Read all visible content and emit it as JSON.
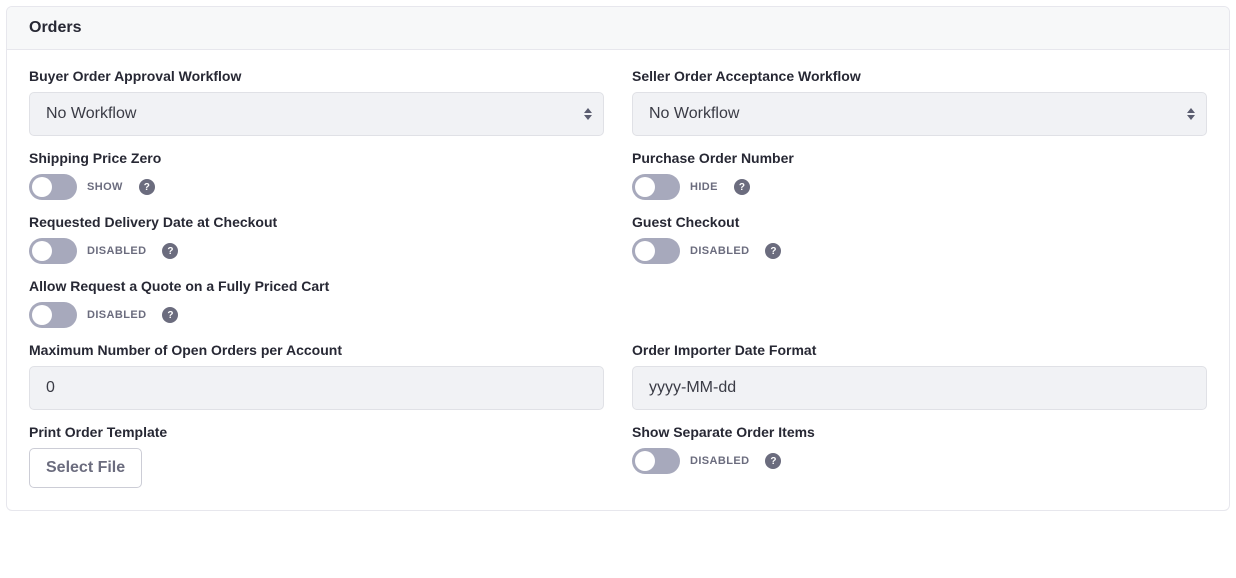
{
  "panel": {
    "title": "Orders"
  },
  "fields": {
    "buyerWorkflow": {
      "label": "Buyer Order Approval Workflow",
      "value": "No Workflow"
    },
    "sellerWorkflow": {
      "label": "Seller Order Acceptance Workflow",
      "value": "No Workflow"
    },
    "shippingPriceZero": {
      "label": "Shipping Price Zero",
      "state": "SHOW"
    },
    "purchaseOrderNumber": {
      "label": "Purchase Order Number",
      "state": "HIDE"
    },
    "requestedDeliveryDate": {
      "label": "Requested Delivery Date at Checkout",
      "state": "DISABLED"
    },
    "guestCheckout": {
      "label": "Guest Checkout",
      "state": "DISABLED"
    },
    "allowQuote": {
      "label": "Allow Request a Quote on a Fully Priced Cart",
      "state": "DISABLED"
    },
    "maxOpenOrders": {
      "label": "Maximum Number of Open Orders per Account",
      "value": "0"
    },
    "importerDateFormat": {
      "label": "Order Importer Date Format",
      "value": "yyyy-MM-dd"
    },
    "printTemplate": {
      "label": "Print Order Template",
      "button": "Select File"
    },
    "separateOrderItems": {
      "label": "Show Separate Order Items",
      "state": "DISABLED"
    }
  },
  "help_glyph": "?"
}
